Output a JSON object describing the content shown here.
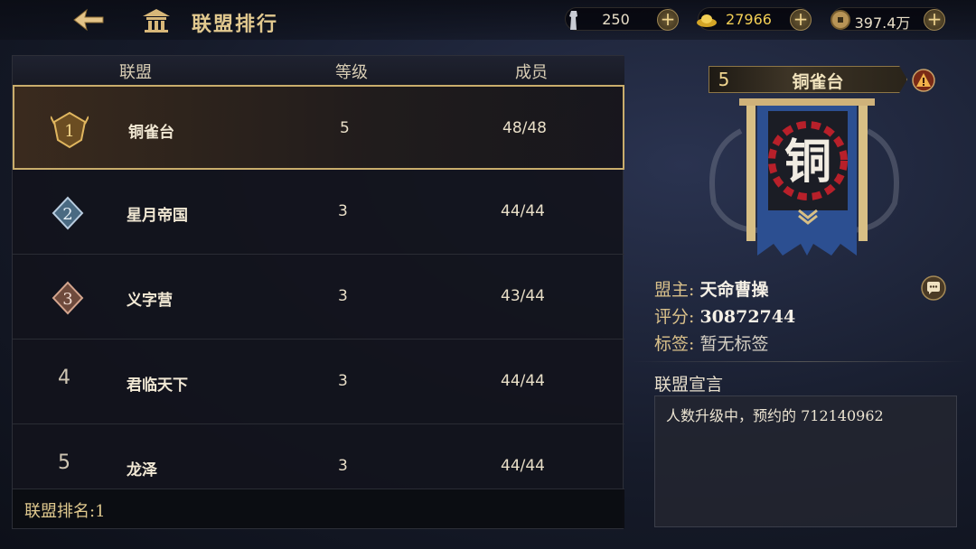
{
  "header": {
    "title": "联盟排行",
    "resources": [
      {
        "icon": "soldier-icon",
        "value": "250"
      },
      {
        "icon": "gold-ingot-icon",
        "value": "27966"
      },
      {
        "icon": "coin-icon",
        "value": "397.4万"
      }
    ]
  },
  "table": {
    "columns": [
      "联盟",
      "等级",
      "成员"
    ],
    "rows": [
      {
        "rank": "1",
        "name": "铜雀台",
        "level": "5",
        "members": "48/48"
      },
      {
        "rank": "2",
        "name": "星月帝国",
        "level": "3",
        "members": "44/44"
      },
      {
        "rank": "3",
        "name": "义字营",
        "level": "3",
        "members": "43/44"
      },
      {
        "rank": "4",
        "name": "君临天下",
        "level": "3",
        "members": "44/44"
      },
      {
        "rank": "5",
        "name": "龙泽",
        "level": "3",
        "members": "44/44"
      }
    ],
    "footer": "联盟排名:1"
  },
  "detail": {
    "level": "5",
    "name": "铜雀台",
    "banner_char": "铜",
    "leader_label": "盟主:",
    "leader": "天命曹操",
    "score_label": "评分:",
    "score": "30872744",
    "tag_label": "标签:",
    "tag": "暂无标签",
    "declaration_title": "联盟宣言",
    "declaration": "人数升级中，预约的 712140962"
  },
  "colors": {
    "accent_gold": "#e2c98f",
    "banner_blue": "#2a4d8f",
    "banner_red": "#b8202a"
  }
}
